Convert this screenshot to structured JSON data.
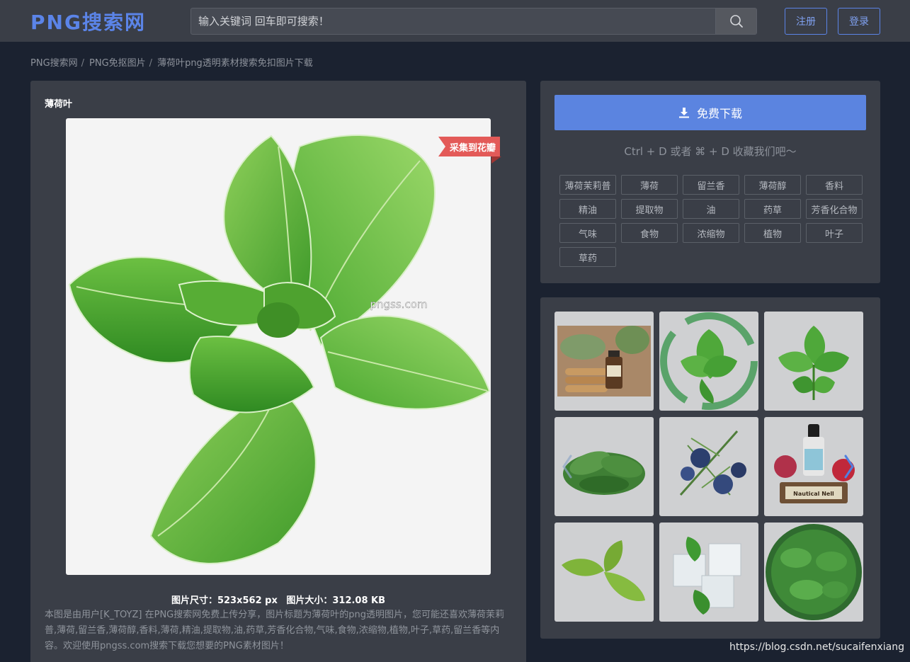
{
  "header": {
    "logo": "PNG搜索网",
    "search_placeholder": "输入关键词 回车即可搜索！",
    "register_label": "注册",
    "login_label": "登录"
  },
  "breadcrumb": [
    "PNG搜索网",
    "PNG免抠图片",
    "薄荷叶png透明素材搜索免扣图片下载"
  ],
  "breadcrumb_sep": "/",
  "image": {
    "title": "薄荷叶",
    "watermark": "pngss.com",
    "ribbon_label": "采集到花瓣",
    "size_text": "图片尺寸：523x562 px",
    "filesize_text": "图片大小：312.08 KB",
    "description": "本图是由用户[K_TOYZ] 在PNG搜索网免费上传分享，图片标题为薄荷叶的png透明图片，您可能还喜欢薄荷茉莉普,薄荷,留兰香,薄荷醇,香料,薄荷,精油,提取物,油,药草,芳香化合物,气味,食物,浓缩物,植物,叶子,草药,留兰香等内容。欢迎使用pngss.com搜索下载您想要的PNG素材图片！"
  },
  "download": {
    "button_label": "免费下载",
    "bookmark_hint": "Ctrl + D 或者 ⌘ + D 收藏我们吧～"
  },
  "tags": [
    "薄荷茉莉普",
    "薄荷",
    "留兰香",
    "薄荷醇",
    "香料",
    "精油",
    "提取物",
    "油",
    "药草",
    "芳香化合物",
    "气味",
    "食物",
    "浓缩物",
    "植物",
    "叶子",
    "草药"
  ],
  "related": {
    "thumb_labels": [
      "Nautical Nell"
    ]
  },
  "colors": {
    "accent": "#5b84e8",
    "ribbon": "#e35a58",
    "panel": "#3a3e47",
    "background": "#1b2230"
  },
  "footer_watermark": "https://blog.csdn.net/sucaifenxiang"
}
